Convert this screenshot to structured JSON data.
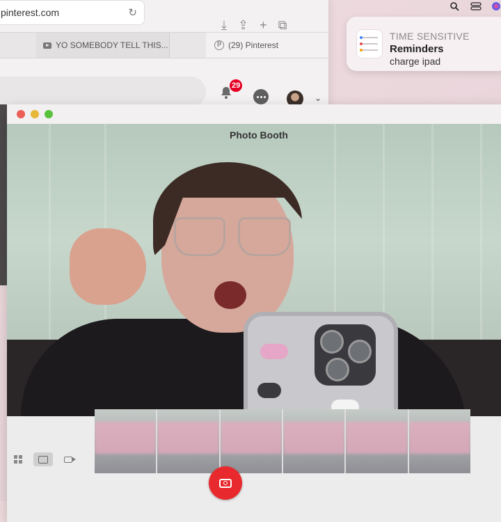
{
  "browser": {
    "url": "pinterest.com",
    "tabs": [
      {
        "label": ""
      },
      {
        "label": "YO SOMEBODY TELL THIS..."
      },
      {
        "label": "(29) Pinterest"
      }
    ],
    "notifications_count": "29"
  },
  "notification": {
    "kind": "TIME SENSITIVE",
    "title": "Reminders",
    "body": "charge ipad"
  },
  "photo_booth": {
    "title": "Photo Booth",
    "modes": [
      "grid-view",
      "single-photo",
      "video"
    ],
    "active_mode": "single-photo"
  }
}
